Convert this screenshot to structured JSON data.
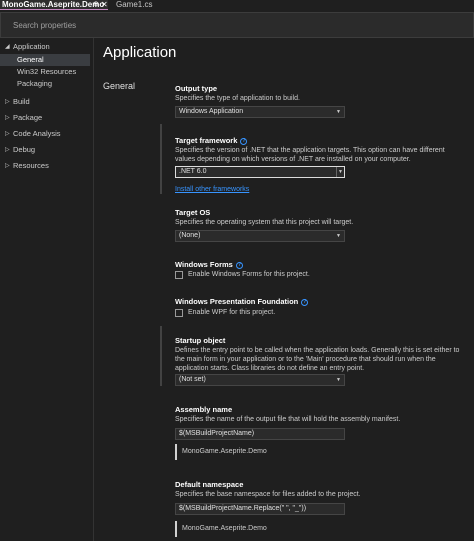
{
  "tabs": {
    "active_label": "MonoGame.Aseprite.Demo",
    "pin_glyph": "⊕",
    "close_glyph": "✕",
    "inactive_label": "Game1.cs"
  },
  "search": {
    "placeholder": "Search properties"
  },
  "sidebar": {
    "items": [
      {
        "label": "Application",
        "expanded": true
      },
      {
        "label": "General",
        "selected": true
      },
      {
        "label": "Win32 Resources"
      },
      {
        "label": "Packaging"
      },
      {
        "label": "Build",
        "expanded": false
      },
      {
        "label": "Package",
        "expanded": false
      },
      {
        "label": "Code Analysis",
        "expanded": false
      },
      {
        "label": "Debug",
        "expanded": false
      },
      {
        "label": "Resources",
        "expanded": false
      }
    ]
  },
  "main": {
    "heading": "Application",
    "section_label": "General",
    "properties": {
      "output_type": {
        "title": "Output type",
        "description": "Specifies the type of application to build.",
        "value": "Windows Application"
      },
      "target_framework": {
        "title": "Target framework",
        "description": "Specifies the version of .NET that the application targets. This option can have different values depending on which versions of .NET are installed on your computer.",
        "value": ".NET 6.0",
        "link": "Install other frameworks"
      },
      "target_os": {
        "title": "Target OS",
        "description": "Specifies the operating system that this project will target.",
        "value": "(None)"
      },
      "windows_forms": {
        "title": "Windows Forms",
        "checkbox_label": "Enable Windows Forms for this project.",
        "checked": false
      },
      "wpf": {
        "title": "Windows Presentation Foundation",
        "checkbox_label": "Enable WPF for this project.",
        "checked": false
      },
      "startup_object": {
        "title": "Startup object",
        "description": "Defines the entry point to be called when the application loads. Generally this is set either to the main form in your application or to the 'Main' procedure that should run when the application starts. Class libraries do not define an entry point.",
        "value": "(Not set)"
      },
      "assembly_name": {
        "title": "Assembly name",
        "description": "Specifies the name of the output file that will hold the assembly manifest.",
        "value": "$(MSBuildProjectName)",
        "preview": "MonoGame.Aseprite.Demo"
      },
      "default_namespace": {
        "title": "Default namespace",
        "description": "Specifies the base namespace for files added to the project.",
        "value": "$(MSBuildProjectName.Replace(\" \", \"_\"))",
        "preview": "MonoGame.Aseprite.Demo"
      }
    }
  },
  "icons": {
    "expanded_caret": "◢",
    "collapsed_caret": "▷",
    "dropdown": "▼",
    "info": "?"
  },
  "colors": {
    "background": "#1f1f1f",
    "link": "#3794ff",
    "active_tab_underline": "#c586c0",
    "selected_nav": "#3a3d41"
  }
}
